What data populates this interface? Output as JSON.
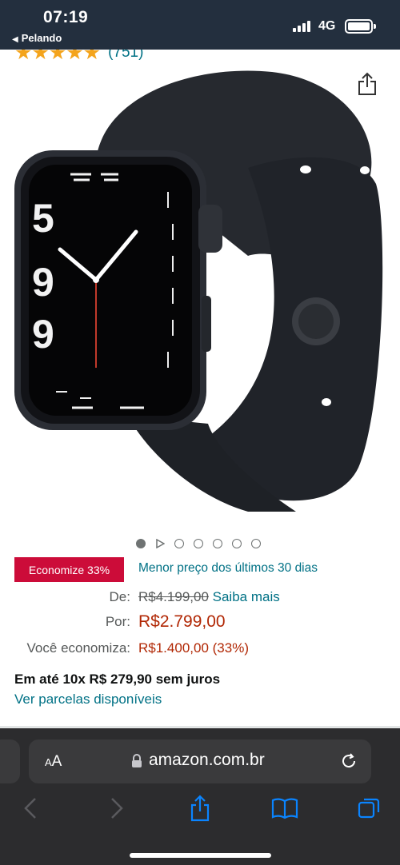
{
  "status_bar": {
    "time": "07:19",
    "back_app": "Pelando",
    "network": "4G",
    "icons": [
      "signal-icon",
      "battery-icon"
    ]
  },
  "product": {
    "rating_stars": "★★★★★",
    "rating_count": "(751)",
    "image_alt": "Apple Watch Series 7 Midnight aluminum case with black sport band",
    "carousel": {
      "total_dots": 7,
      "active_index": 0,
      "video_index": 1
    }
  },
  "deal": {
    "badge": "Economize 33%",
    "text": "Menor preço dos últimos 30 dias"
  },
  "pricing": {
    "list_label": "De:",
    "list_price": "R$4.199,00",
    "learn_more": "Saiba mais",
    "price_label": "Por:",
    "price": "R$2.799,00",
    "savings_label": "Você economiza:",
    "savings": "R$1.400,00 (33%)"
  },
  "installments": {
    "text": "Em até 10x R$ 279,90 sem juros",
    "link": "Ver parcelas disponíveis"
  },
  "browser": {
    "text_size": "AA",
    "url": "amazon.com.br",
    "toolbar": [
      "back-icon",
      "forward-icon",
      "share-icon",
      "bookmarks-icon",
      "tabs-icon"
    ]
  },
  "colors": {
    "status_bar": "#232f3e",
    "link": "#007185",
    "deal_badge": "#cc0c39",
    "price": "#b12704",
    "star": "#f4a41c",
    "ios_blue": "#0a84ff"
  }
}
